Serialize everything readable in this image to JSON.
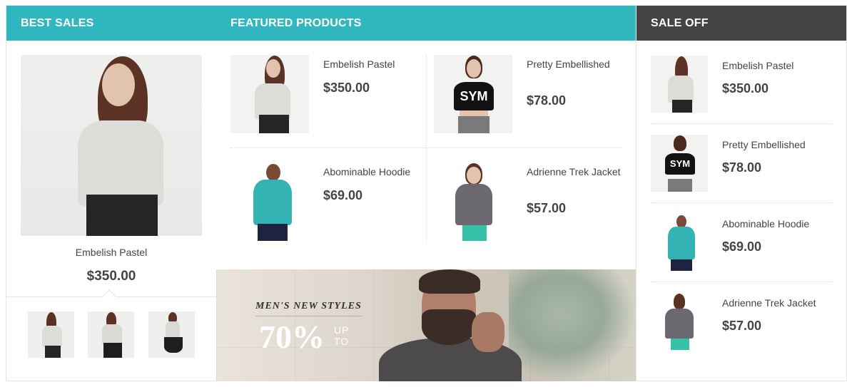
{
  "best_sales": {
    "title": "BEST SALES",
    "featured": {
      "name": "Embelish Pastel",
      "price": "$350.00"
    },
    "thumbnails": [
      "thumbnail-1",
      "thumbnail-2",
      "thumbnail-3"
    ]
  },
  "featured_products": {
    "title": "FEATURED PRODUCTS",
    "items": [
      {
        "name": "Embelish Pastel",
        "price": "$350.00"
      },
      {
        "name": "Pretty Embellished",
        "price": "$78.00"
      },
      {
        "name": "Abominable Hoodie",
        "price": "$69.00"
      },
      {
        "name": "Adrienne Trek Jacket",
        "price": "$57.00"
      }
    ],
    "banner": {
      "slogan": "MEN'S NEW STYLES",
      "percent": "70%",
      "up": "UP",
      "to": "TO"
    }
  },
  "sale_off": {
    "title": "SALE OFF",
    "items": [
      {
        "name": "Embelish Pastel",
        "price": "$350.00"
      },
      {
        "name": "Pretty Embellished",
        "price": "$78.00"
      },
      {
        "name": "Abominable Hoodie",
        "price": "$69.00"
      },
      {
        "name": "Adrienne Trek Jacket",
        "price": "$57.00"
      }
    ]
  },
  "colors": {
    "teal": "#31b7c0",
    "dark_header": "#444444",
    "text": "#444444"
  },
  "icons": {
    "sym_print": "SYM"
  }
}
